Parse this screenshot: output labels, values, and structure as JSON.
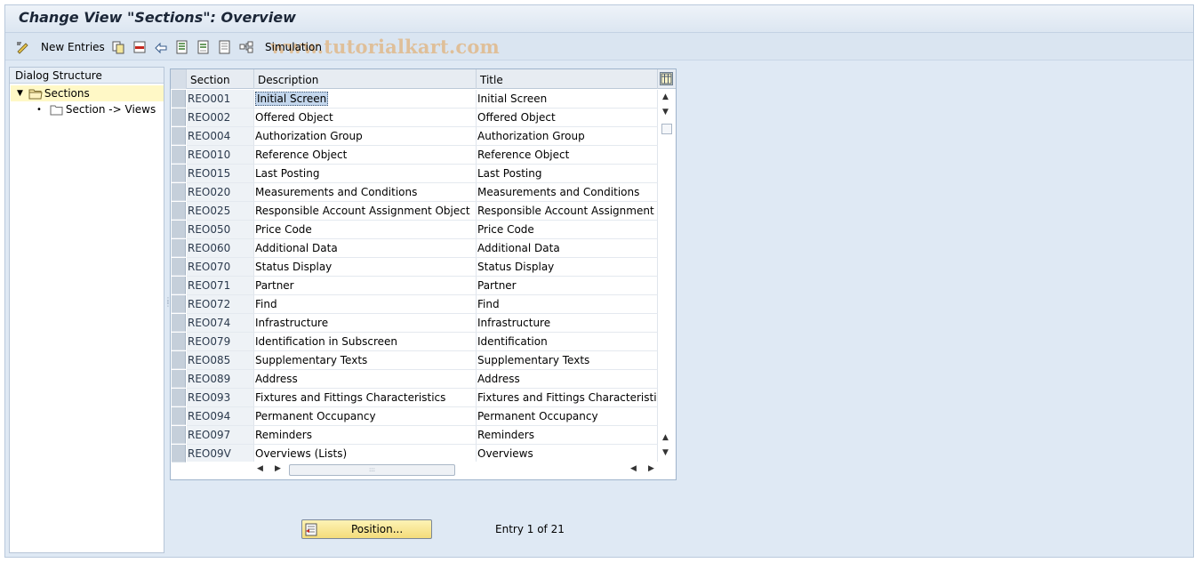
{
  "window": {
    "title": "Change View \"Sections\": Overview"
  },
  "toolbar": {
    "items": [
      {
        "name": "display-change-icon",
        "label": ""
      },
      {
        "name": "new-entries-button",
        "label": "New Entries"
      },
      {
        "name": "copy-as-icon",
        "label": ""
      },
      {
        "name": "delete-icon",
        "label": ""
      },
      {
        "name": "undo-change-icon",
        "label": ""
      },
      {
        "name": "select-all-icon",
        "label": ""
      },
      {
        "name": "select-block-icon",
        "label": ""
      },
      {
        "name": "deselect-all-icon",
        "label": ""
      },
      {
        "name": "simulation-icon",
        "label": ""
      }
    ],
    "new_entries_label": "New Entries",
    "simulation_label": "Simulation",
    "watermark": "www.tutorialkart.com"
  },
  "dialog_structure": {
    "header": "Dialog Structure",
    "items": [
      {
        "label": "Sections",
        "selected": true,
        "expanded": true,
        "level": 0
      },
      {
        "label": "Section -> Views",
        "selected": false,
        "level": 1
      }
    ]
  },
  "table": {
    "columns": [
      "Section",
      "Description",
      "Title"
    ],
    "rows": [
      {
        "section": "REO001",
        "description": "Initial Screen",
        "title": "Initial Screen"
      },
      {
        "section": "REO002",
        "description": "Offered Object",
        "title": "Offered Object"
      },
      {
        "section": "REO004",
        "description": "Authorization Group",
        "title": "Authorization Group"
      },
      {
        "section": "REO010",
        "description": "Reference Object",
        "title": "Reference Object"
      },
      {
        "section": "REO015",
        "description": "Last Posting",
        "title": "Last Posting"
      },
      {
        "section": "REO020",
        "description": "Measurements and Conditions",
        "title": "Measurements and Conditions"
      },
      {
        "section": "REO025",
        "description": "Responsible Account Assignment Object",
        "title": "Responsible Account Assignment Obj"
      },
      {
        "section": "REO050",
        "description": "Price Code",
        "title": "Price Code"
      },
      {
        "section": "REO060",
        "description": "Additional Data",
        "title": "Additional Data"
      },
      {
        "section": "REO070",
        "description": "Status Display",
        "title": "Status Display"
      },
      {
        "section": "REO071",
        "description": "Partner",
        "title": "Partner"
      },
      {
        "section": "REO072",
        "description": "Find",
        "title": "Find"
      },
      {
        "section": "REO074",
        "description": "Infrastructure",
        "title": "Infrastructure"
      },
      {
        "section": "REO079",
        "description": "Identification in Subscreen",
        "title": "Identification"
      },
      {
        "section": "REO085",
        "description": "Supplementary Texts",
        "title": "Supplementary Texts"
      },
      {
        "section": "REO089",
        "description": "Address",
        "title": "Address"
      },
      {
        "section": "REO093",
        "description": "Fixtures and Fittings Characteristics",
        "title": "Fixtures and Fittings Characteristics"
      },
      {
        "section": "REO094",
        "description": "Permanent Occupancy",
        "title": "Permanent Occupancy"
      },
      {
        "section": "REO097",
        "description": "Reminders",
        "title": "Reminders"
      },
      {
        "section": "REO09V",
        "description": "Overviews (Lists)",
        "title": "Overviews"
      }
    ]
  },
  "footer": {
    "position_button": "Position...",
    "entry_info": "Entry 1 of 21"
  },
  "colors": {
    "background": "#dfe9f4",
    "selection": "#fff8c6",
    "button": "#f4dc7b"
  }
}
